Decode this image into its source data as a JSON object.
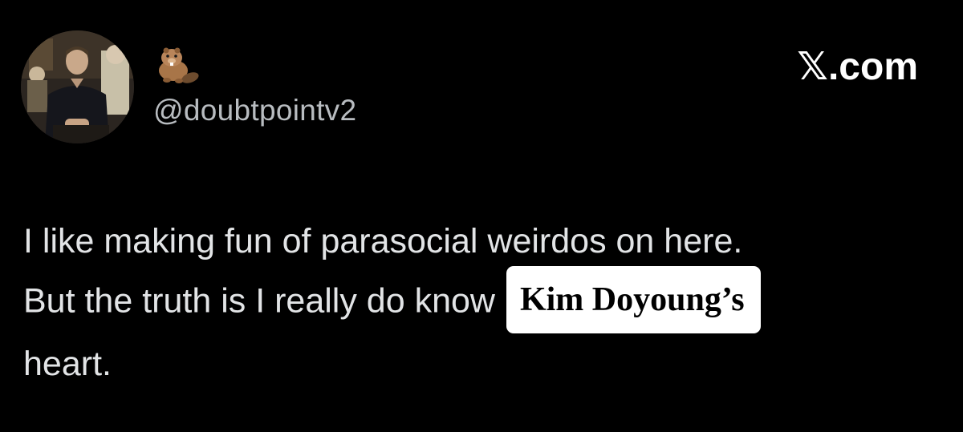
{
  "tweet": {
    "author_emoji": "beaver-emoji",
    "handle": "@doubtpointv2",
    "source": "𝕏.com",
    "lines": [
      "I like making fun of parasocial weirdos on here.",
      "But the truth is I really do know",
      "heart."
    ],
    "highlight": "Kim Doyoung’s"
  },
  "colors": {
    "background": "#000000",
    "text": "#e2e4e6",
    "handle": "#b8bcc0",
    "sticker_bg": "#ffffff",
    "sticker_text": "#000000"
  }
}
